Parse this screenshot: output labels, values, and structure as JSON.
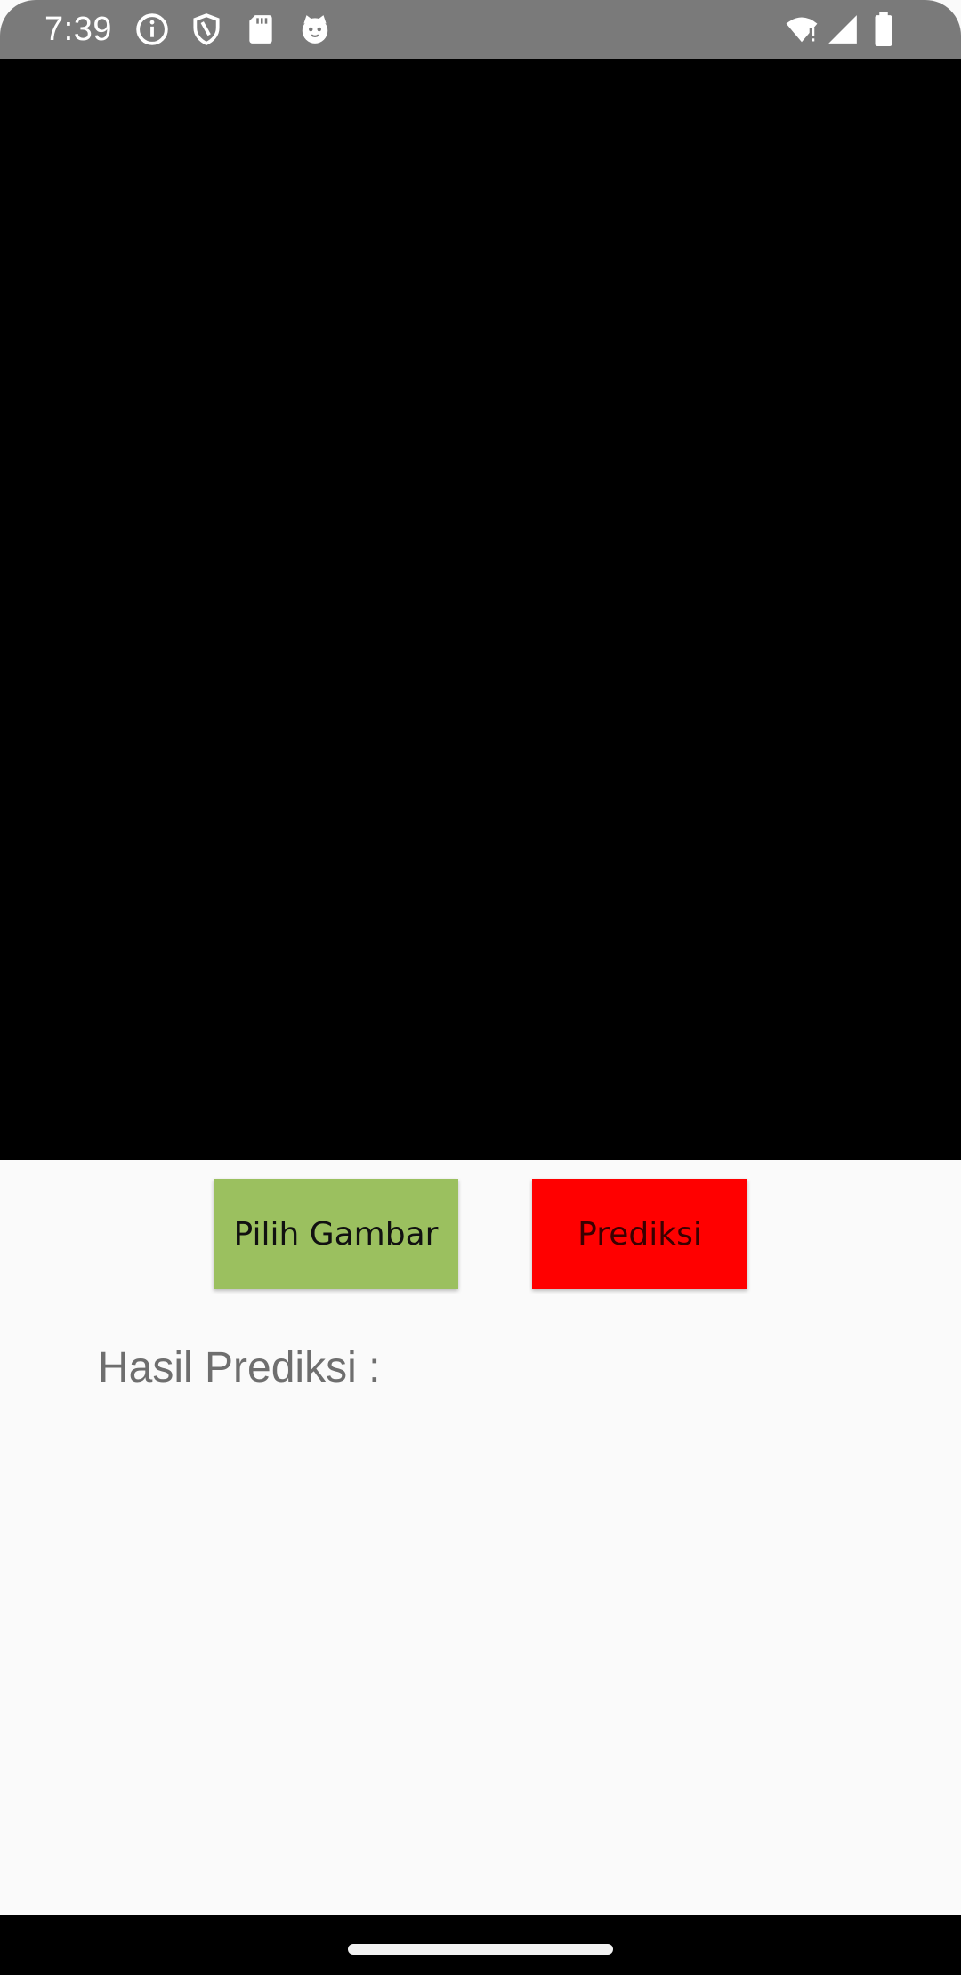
{
  "status_bar": {
    "time": "7:39",
    "left_icons": [
      "info-icon",
      "shield-icon",
      "sd-card-icon",
      "cat-face-icon"
    ],
    "right_icons": [
      "wifi-alert-icon",
      "cell-signal-icon",
      "battery-icon"
    ],
    "background": "#7a7a7a"
  },
  "image_preview": {
    "background": "#000000"
  },
  "actions": {
    "pick_label": "Pilih Gambar",
    "pick_color": "#9bc05f",
    "predict_label": "Prediksi",
    "predict_color": "#ff0000"
  },
  "result": {
    "label": "Hasil Prediksi :"
  }
}
